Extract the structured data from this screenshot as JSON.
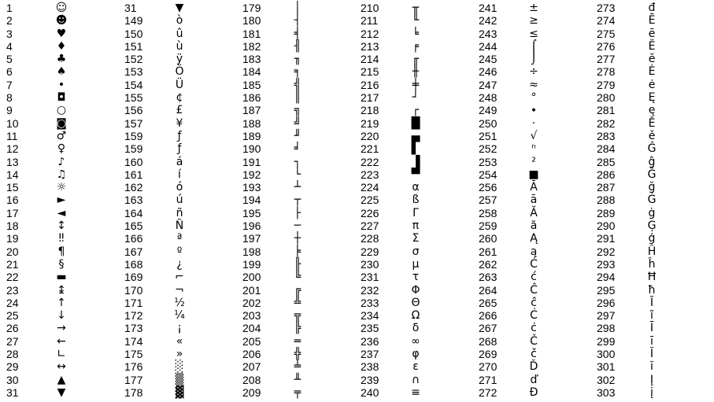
{
  "description": "ASCII / extended code-page character table fragment, six number–glyph column pairs × 31 rows",
  "columns": [
    {
      "id": "c1",
      "pairs": [
        {
          "n": "1",
          "s": "☺"
        },
        {
          "n": "2",
          "s": "☻"
        },
        {
          "n": "3",
          "s": "♥"
        },
        {
          "n": "4",
          "s": "♦"
        },
        {
          "n": "5",
          "s": "♣"
        },
        {
          "n": "6",
          "s": "♠"
        },
        {
          "n": "7",
          "s": "•"
        },
        {
          "n": "8",
          "s": "◘"
        },
        {
          "n": "9",
          "s": "○"
        },
        {
          "n": "10",
          "s": "◙"
        },
        {
          "n": "11",
          "s": "♂"
        },
        {
          "n": "12",
          "s": "♀"
        },
        {
          "n": "13",
          "s": "♪"
        },
        {
          "n": "14",
          "s": "♫"
        },
        {
          "n": "15",
          "s": "☼"
        },
        {
          "n": "16",
          "s": "►"
        },
        {
          "n": "17",
          "s": "◄"
        },
        {
          "n": "18",
          "s": "↕"
        },
        {
          "n": "19",
          "s": "‼"
        },
        {
          "n": "20",
          "s": "¶"
        },
        {
          "n": "21",
          "s": "§"
        },
        {
          "n": "22",
          "s": "▬"
        },
        {
          "n": "23",
          "s": "↨"
        },
        {
          "n": "24",
          "s": "↑"
        },
        {
          "n": "25",
          "s": "↓"
        },
        {
          "n": "26",
          "s": "→"
        },
        {
          "n": "27",
          "s": "←"
        },
        {
          "n": "28",
          "s": "∟"
        },
        {
          "n": "29",
          "s": "↔"
        },
        {
          "n": "30",
          "s": "▲"
        },
        {
          "n": "31",
          "s": "▼"
        }
      ]
    },
    {
      "id": "c2",
      "pairs": [
        {
          "n": "31",
          "s": "▼"
        },
        {
          "n": "149",
          "s": "ò"
        },
        {
          "n": "150",
          "s": "û"
        },
        {
          "n": "151",
          "s": "ù"
        },
        {
          "n": "152",
          "s": "ÿ"
        },
        {
          "n": "153",
          "s": "Ö"
        },
        {
          "n": "154",
          "s": "Ü"
        },
        {
          "n": "155",
          "s": "¢"
        },
        {
          "n": "156",
          "s": "£"
        },
        {
          "n": "157",
          "s": "¥"
        },
        {
          "n": "159",
          "s": "ƒ"
        },
        {
          "n": "159",
          "s": "ƒ"
        },
        {
          "n": "160",
          "s": "á"
        },
        {
          "n": "161",
          "s": "í"
        },
        {
          "n": "162",
          "s": "ó"
        },
        {
          "n": "163",
          "s": "ú"
        },
        {
          "n": "164",
          "s": "ñ"
        },
        {
          "n": "165",
          "s": "Ñ"
        },
        {
          "n": "166",
          "s": "ª"
        },
        {
          "n": "167",
          "s": "º"
        },
        {
          "n": "168",
          "s": "¿"
        },
        {
          "n": "169",
          "s": "⌐"
        },
        {
          "n": "170",
          "s": "¬"
        },
        {
          "n": "171",
          "s": "½"
        },
        {
          "n": "172",
          "s": "¼"
        },
        {
          "n": "173",
          "s": "¡"
        },
        {
          "n": "174",
          "s": "«"
        },
        {
          "n": "175",
          "s": "»"
        },
        {
          "n": "176",
          "s": "░"
        },
        {
          "n": "177",
          "s": "▒"
        },
        {
          "n": "178",
          "s": "▓"
        }
      ]
    },
    {
      "id": "c3",
      "pairs": [
        {
          "n": "179",
          "s": "│"
        },
        {
          "n": "180",
          "s": "┤"
        },
        {
          "n": "181",
          "s": "╡"
        },
        {
          "n": "182",
          "s": "╢"
        },
        {
          "n": "183",
          "s": "╖"
        },
        {
          "n": "184",
          "s": "╕"
        },
        {
          "n": "185",
          "s": "╣"
        },
        {
          "n": "186",
          "s": "║"
        },
        {
          "n": "187",
          "s": "╗"
        },
        {
          "n": "188",
          "s": "╝"
        },
        {
          "n": "189",
          "s": "╜"
        },
        {
          "n": "190",
          "s": "╛"
        },
        {
          "n": "191",
          "s": "┐"
        },
        {
          "n": "192",
          "s": "└"
        },
        {
          "n": "193",
          "s": "┴"
        },
        {
          "n": "194",
          "s": "┬"
        },
        {
          "n": "195",
          "s": "├"
        },
        {
          "n": "196",
          "s": "─"
        },
        {
          "n": "197",
          "s": "┼"
        },
        {
          "n": "198",
          "s": "╞"
        },
        {
          "n": "199",
          "s": "╟"
        },
        {
          "n": "200",
          "s": "╚"
        },
        {
          "n": "201",
          "s": "╔"
        },
        {
          "n": "202",
          "s": "╩"
        },
        {
          "n": "203",
          "s": "╦"
        },
        {
          "n": "204",
          "s": "╠"
        },
        {
          "n": "205",
          "s": "═"
        },
        {
          "n": "206",
          "s": "╬"
        },
        {
          "n": "207",
          "s": "╧"
        },
        {
          "n": "208",
          "s": "╨"
        },
        {
          "n": "209",
          "s": "╤"
        }
      ]
    },
    {
      "id": "c4",
      "pairs": [
        {
          "n": "210",
          "s": "╥"
        },
        {
          "n": "211",
          "s": "╙"
        },
        {
          "n": "212",
          "s": "╘"
        },
        {
          "n": "213",
          "s": "╒"
        },
        {
          "n": "214",
          "s": "╓"
        },
        {
          "n": "215",
          "s": "╫"
        },
        {
          "n": "216",
          "s": "╪"
        },
        {
          "n": "217",
          "s": "┘"
        },
        {
          "n": "218",
          "s": "┌"
        },
        {
          "n": "219",
          "s": "█"
        },
        {
          "n": "220",
          "s": "▄"
        },
        {
          "n": "221",
          "s": "▌"
        },
        {
          "n": "222",
          "s": "▐"
        },
        {
          "n": "223",
          "s": "▀"
        },
        {
          "n": "224",
          "s": "α"
        },
        {
          "n": "225",
          "s": "ß"
        },
        {
          "n": "226",
          "s": "Γ"
        },
        {
          "n": "227",
          "s": "π"
        },
        {
          "n": "228",
          "s": "Σ"
        },
        {
          "n": "229",
          "s": "σ"
        },
        {
          "n": "230",
          "s": "µ"
        },
        {
          "n": "231",
          "s": "τ"
        },
        {
          "n": "232",
          "s": "Φ"
        },
        {
          "n": "233",
          "s": "Θ"
        },
        {
          "n": "234",
          "s": "Ω"
        },
        {
          "n": "235",
          "s": "δ"
        },
        {
          "n": "236",
          "s": "∞"
        },
        {
          "n": "237",
          "s": "φ"
        },
        {
          "n": "238",
          "s": "ε"
        },
        {
          "n": "239",
          "s": "∩"
        },
        {
          "n": "240",
          "s": "≡"
        }
      ]
    },
    {
      "id": "c5",
      "pairs": [
        {
          "n": "241",
          "s": "±"
        },
        {
          "n": "242",
          "s": "≥"
        },
        {
          "n": "243",
          "s": "≤"
        },
        {
          "n": "244",
          "s": "⌠"
        },
        {
          "n": "245",
          "s": "⌡"
        },
        {
          "n": "246",
          "s": "÷"
        },
        {
          "n": "247",
          "s": "≈"
        },
        {
          "n": "248",
          "s": "°"
        },
        {
          "n": "249",
          "s": "∙"
        },
        {
          "n": "250",
          "s": "·"
        },
        {
          "n": "251",
          "s": "√"
        },
        {
          "n": "252",
          "s": "ⁿ"
        },
        {
          "n": "253",
          "s": "²"
        },
        {
          "n": "254",
          "s": "■"
        },
        {
          "n": "256",
          "s": "Ā"
        },
        {
          "n": "257",
          "s": "ā"
        },
        {
          "n": "258",
          "s": "Ă"
        },
        {
          "n": "259",
          "s": "ă"
        },
        {
          "n": "260",
          "s": "Ą"
        },
        {
          "n": "261",
          "s": "ą"
        },
        {
          "n": "262",
          "s": "Ć"
        },
        {
          "n": "263",
          "s": "ć"
        },
        {
          "n": "264",
          "s": "Ĉ"
        },
        {
          "n": "265",
          "s": "ĉ"
        },
        {
          "n": "266",
          "s": "Ċ"
        },
        {
          "n": "267",
          "s": "ċ"
        },
        {
          "n": "268",
          "s": "Č"
        },
        {
          "n": "269",
          "s": "č"
        },
        {
          "n": "270",
          "s": "Ď"
        },
        {
          "n": "271",
          "s": "ď"
        },
        {
          "n": "272",
          "s": "Đ"
        }
      ]
    },
    {
      "id": "c6",
      "pairs": [
        {
          "n": "273",
          "s": "đ"
        },
        {
          "n": "274",
          "s": "Ē"
        },
        {
          "n": "275",
          "s": "ē"
        },
        {
          "n": "276",
          "s": "Ĕ"
        },
        {
          "n": "277",
          "s": "ĕ"
        },
        {
          "n": "278",
          "s": "Ė"
        },
        {
          "n": "279",
          "s": "ė"
        },
        {
          "n": "280",
          "s": "Ę"
        },
        {
          "n": "281",
          "s": "ę"
        },
        {
          "n": "282",
          "s": "Ě"
        },
        {
          "n": "283",
          "s": "ě"
        },
        {
          "n": "284",
          "s": "Ĝ"
        },
        {
          "n": "285",
          "s": "ĝ"
        },
        {
          "n": "286",
          "s": "Ğ"
        },
        {
          "n": "287",
          "s": "ğ"
        },
        {
          "n": "288",
          "s": "Ġ"
        },
        {
          "n": "289",
          "s": "ġ"
        },
        {
          "n": "290",
          "s": "Ģ"
        },
        {
          "n": "291",
          "s": "ģ"
        },
        {
          "n": "292",
          "s": "Ĥ"
        },
        {
          "n": "293",
          "s": "ĥ"
        },
        {
          "n": "294",
          "s": "Ħ"
        },
        {
          "n": "295",
          "s": "ħ"
        },
        {
          "n": "296",
          "s": "Ĩ"
        },
        {
          "n": "297",
          "s": "ĩ"
        },
        {
          "n": "298",
          "s": "Ī"
        },
        {
          "n": "299",
          "s": "ī"
        },
        {
          "n": "300",
          "s": "Ĭ"
        },
        {
          "n": "301",
          "s": "ĭ"
        },
        {
          "n": "302",
          "s": "Į"
        },
        {
          "n": "303",
          "s": "į"
        }
      ]
    }
  ]
}
